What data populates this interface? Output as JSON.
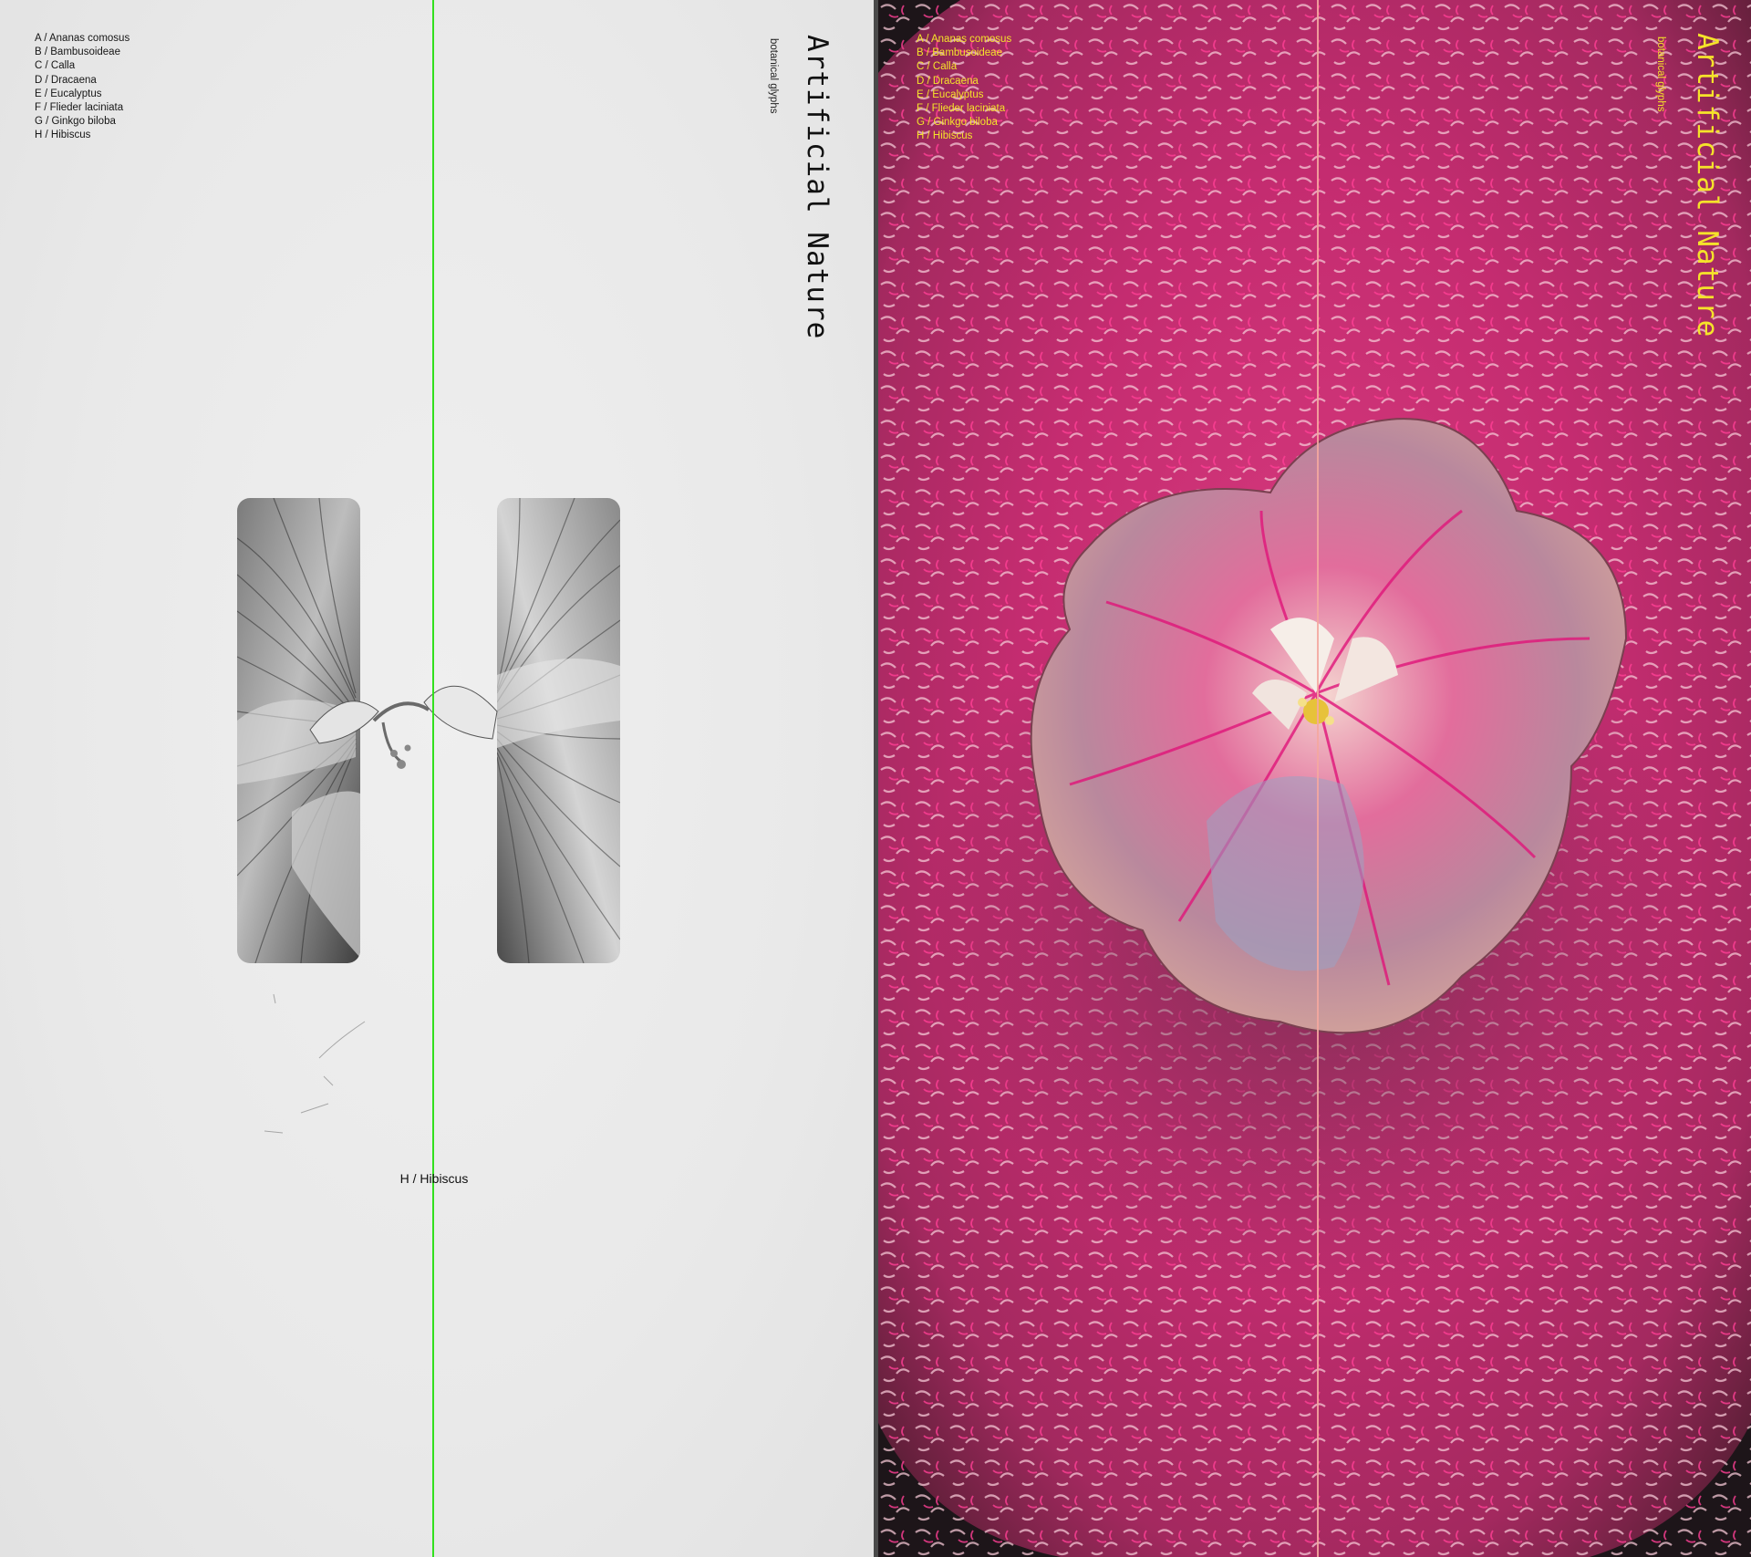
{
  "glyph_list": [
    "A / Ananas comosus",
    "B / Bambusoideae",
    "C / Calla",
    "D / Dracaena",
    "E / Eucalyptus",
    "F / Flieder laciniata",
    "G / Ginkgo biloba",
    "H / Hibiscus"
  ],
  "title": "Artificial Nature",
  "subtitle": "botanical glyphs",
  "current_glyph": "H / Hibiscus",
  "colors": {
    "guide_left": "#32e01e",
    "guide_right": "#f4a7a0",
    "accent_text_right": "#f5e32a",
    "flower_magenta": "#e2197c",
    "petal_pink": "#e9a8b6"
  },
  "icons": {
    "left_artwork": "hibiscus-letter-h-illustration",
    "right_artwork": "hibiscus-flower-photo"
  }
}
